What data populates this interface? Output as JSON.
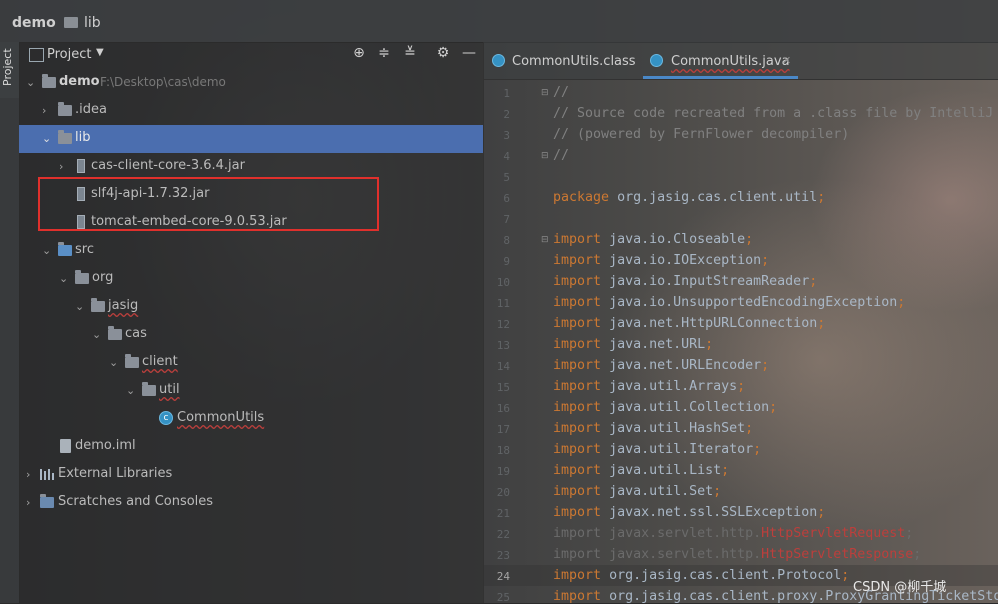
{
  "breadcrumb": {
    "project": "demo",
    "folder": "lib"
  },
  "tool_window": {
    "tab_label": "Project"
  },
  "project_panel": {
    "title": "Project",
    "tree": [
      {
        "label": "demo",
        "hint": "F:\\Desktop\\cas\\demo"
      },
      {
        "label": ".idea"
      },
      {
        "label": "lib"
      },
      {
        "label": "cas-client-core-3.6.4.jar"
      },
      {
        "label": "slf4j-api-1.7.32.jar"
      },
      {
        "label": "tomcat-embed-core-9.0.53.jar"
      },
      {
        "label": "src"
      },
      {
        "label": "org"
      },
      {
        "label": "jasig"
      },
      {
        "label": "cas"
      },
      {
        "label": "client"
      },
      {
        "label": "util"
      },
      {
        "label": "CommonUtils"
      },
      {
        "label": "demo.iml"
      },
      {
        "label": "External Libraries"
      },
      {
        "label": "Scratches and Consoles"
      }
    ]
  },
  "editor_tabs": [
    {
      "label": "CommonUtils.class"
    },
    {
      "label": "CommonUtils.java"
    }
  ],
  "editor": {
    "line_numbers": [
      "1",
      "2",
      "3",
      "4",
      "5",
      "6",
      "7",
      "8",
      "9",
      "10",
      "11",
      "12",
      "13",
      "14",
      "15",
      "16",
      "17",
      "18",
      "19",
      "20",
      "21",
      "22",
      "23",
      "24",
      "25"
    ],
    "comment_lines": [
      "//",
      "// Source code recreated from a .class file by IntelliJ",
      "// (powered by FernFlower decompiler)",
      "//"
    ],
    "package_kw": "package",
    "package_name": "org.jasig.cas.client.util",
    "import_kw": "import",
    "imports": [
      "java.io.Closeable",
      "java.io.IOException",
      "java.io.InputStreamReader",
      "java.io.UnsupportedEncodingException",
      "java.net.HttpURLConnection",
      "java.net.URL",
      "java.net.URLEncoder",
      "java.util.Arrays",
      "java.util.Collection",
      "java.util.HashSet",
      "java.util.Iterator",
      "java.util.List",
      "java.util.Set",
      "javax.net.ssl.SSLException"
    ],
    "unresolved_imports": [
      {
        "pkg": "javax.servlet.http.",
        "cls": "HttpServletRequest"
      },
      {
        "pkg": "javax.servlet.http.",
        "cls": "HttpServletResponse"
      }
    ],
    "tail_imports": [
      "org.jasig.cas.client.Protocol",
      "org.jasig.cas.client.proxy.ProxyGrantingTicketSto"
    ]
  },
  "watermark": "CSDN @柳千城",
  "colors": {
    "selection": "#4b6eaf",
    "highlight_box": "#e0302c",
    "keyword": "#cc7832",
    "error": "#bc3f3c"
  }
}
